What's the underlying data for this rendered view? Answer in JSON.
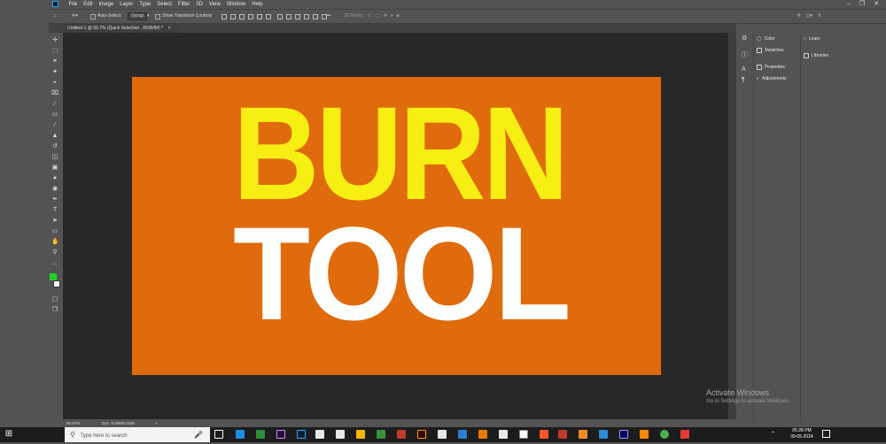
{
  "menubar": {
    "items": [
      "File",
      "Edit",
      "Image",
      "Layer",
      "Type",
      "Select",
      "Filter",
      "3D",
      "View",
      "Window",
      "Help"
    ]
  },
  "options": {
    "auto_select": "Auto-Select:",
    "group": "Group",
    "show_transform": "Show Transform Controls",
    "mode_3d": "3D Mode:"
  },
  "document": {
    "tab_title": "Untitled-1 @ 66.7% (Quick Selection , RGB/8#) *",
    "close": "×"
  },
  "canvas": {
    "line1": "BURN",
    "line2": "TOOL",
    "artboard_color": "#e06b0c",
    "line1_color": "#f7ee14",
    "line2_color": "#ffffff"
  },
  "panels": {
    "group1": [
      "Color",
      "Swatches"
    ],
    "group2": [
      "Properties",
      "Adjustments"
    ],
    "far": [
      "Learn",
      "Libraries"
    ]
  },
  "status": {
    "zoom": "66.67%",
    "doc": "Doc: 5.93M/4.00M",
    "arrow": ">"
  },
  "watermark": {
    "title": "Activate Windows",
    "subtitle": "Go to Settings to activate Windows."
  },
  "taskbar": {
    "search_placeholder": "Type here to search",
    "time": "05:28 PM",
    "date": "09-05-2024"
  }
}
